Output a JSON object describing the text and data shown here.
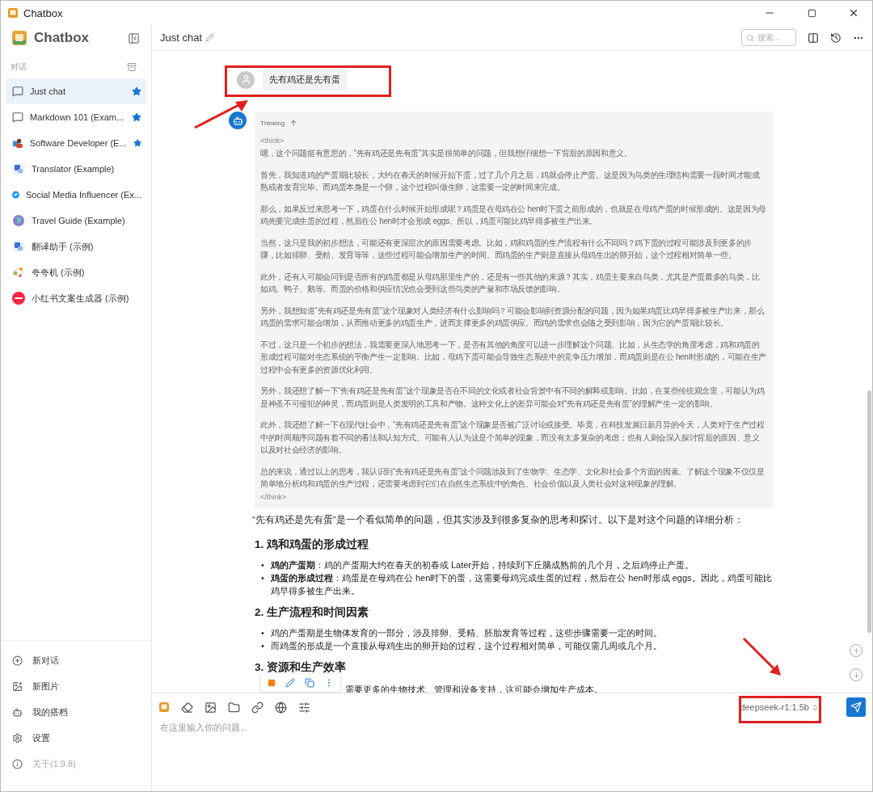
{
  "window": {
    "title": "Chatbox"
  },
  "sidebar": {
    "app_name": "Chatbox",
    "section_label": "对话",
    "items": [
      {
        "title": "Just chat",
        "kind": "chat",
        "starred": true,
        "selected": true
      },
      {
        "title": "Markdown 101 (Exam...",
        "kind": "chat",
        "starred": true,
        "selected": false
      },
      {
        "title": "Software Developer (E...",
        "kind": "developer",
        "starred": true,
        "selected": false
      },
      {
        "title": "Translator (Example)",
        "kind": "translate",
        "starred": false,
        "selected": false
      },
      {
        "title": "Social Media Influencer (Ex...",
        "kind": "bird",
        "starred": false,
        "selected": false
      },
      {
        "title": "Travel Guide (Example)",
        "kind": "globe",
        "starred": false,
        "selected": false
      },
      {
        "title": "翻译助手 (示例)",
        "kind": "translate",
        "starred": false,
        "selected": false
      },
      {
        "title": "夸夸机 (示例)",
        "kind": "sparkle",
        "starred": false,
        "selected": false
      },
      {
        "title": "小红书文案生成器 (示例)",
        "kind": "badge",
        "starred": false,
        "selected": false
      }
    ],
    "actions": [
      {
        "label": "新对话",
        "kind": "plus"
      },
      {
        "label": "新图片",
        "kind": "image"
      },
      {
        "label": "我的搭档",
        "kind": "bot"
      },
      {
        "label": "设置",
        "kind": "gear"
      },
      {
        "label": "关于(1.9.8)",
        "kind": "info"
      }
    ]
  },
  "header": {
    "title": "Just chat",
    "search_placeholder": "搜索..."
  },
  "user_message": {
    "text": "先有鸡还是先有蛋"
  },
  "thinking": {
    "label": "Thinking",
    "open_tag": "<think>",
    "close_tag": "</think>",
    "paragraphs": [
      "嗯，这个问题挺有意思的，“先有鸡还是先有蛋”其实是很简单的问题，但我想仔细想一下背后的原因和意义。",
      "首先，我知道鸡的产蛋期比较长，大约在春天的时候开始下蛋，过了几个月之后，鸡就会停止产蛋。这是因为鸟类的生理结构需要一段时间才能成熟或者发育完毕。而鸡蛋本身是一个卵，这个过程叫做生卵，这需要一定的时间来完成。",
      "那么，如果反过来思考一下，鸡蛋在什么时候开始形成呢？鸡蛋是在母鸡在公 hen时下蛋之前形成的，也就是在母鸡产蛋的时候形成的。这是因为母鸡先要完成生蛋的过程，然后在公 hen时才会形成 eggs。所以，鸡蛋可能比鸡早得多被生产出来。",
      "当然，这只是我的初步想法，可能还有更深层次的原因需要考虑。比如，鸡和鸡蛋的生产流程有什么不同吗？鸡下蛋的过程可能涉及到更多的步骤，比如排卵、受精、发育等等，这些过程可能会增加生产的时间。而鸡蛋的生产则是直接从母鸡生出的卵开始，这个过程相对简单一些。",
      "此外，还有人可能会问到是否所有的鸡蛋都是从母鸡那里生产的，还是有一些其他的来源？其实，鸡蛋主要来自鸟类，尤其是产蛋最多的鸟类，比如鸡、鸭子、鹅等。而蛋的价格和供应情况也会受到这些鸟类的产量和市场反馈的影响。",
      "另外，我想知道“先有鸡还是先有蛋”这个现象对人类经济有什么影响吗？可能会影响到资源分配的问题，因为如果鸡蛋比鸡早得多被生产出来，那么鸡蛋的需求可能会增加，从而推动更多的鸡蛋生产，进而支撑更多的鸡蛋供应。而鸡的需求也会随之受到影响，因为它的产蛋期比较长。",
      "不过，这只是一个初步的想法，我需要更深入地思考一下，是否有其他的角度可以进一步理解这个问题。比如，从生态学的角度考虑，鸡和鸡蛋的形成过程可能对生态系统的平衡产生一定影响。比如，母鸡下蛋可能会导致生态系统中的竞争压力增加，而鸡蛋则是在公 hen时形成的，可能在生产过程中会有更多的资源优化利用。",
      "另外，我还想了解一下“先有鸡还是先有蛋”这个现象是否在不同的文化或者社会背景中有不同的解释或影响。比如，在某些传统观念里，可能认为鸡是神圣不可侵犯的神灵，而鸡蛋则是人类发明的工具和产物。这种文化上的差异可能会对“先有鸡还是先有蛋”的理解产生一定的影响。",
      "此外，我还想了解一下在现代社会中，“先有鸡还是先有蛋”这个现象是否被广泛讨论或接受。毕竟，在科技发展日新月异的今天，人类对于生产过程中的时间顺序问题有着不同的看法和认知方式。可能有人认为这是个简单的现象，而没有太多复杂的考虑；也有人则会深入探讨背后的原因、意义以及对社会经济的影响。",
      "总的来说，通过以上的思考，我认识到“先有鸡还是先有蛋”这个问题涉及到了生物学、生态学、文化和社会多个方面的因素。了解这个现象不仅仅是简单地分析鸡和鸡蛋的生产过程，还需要考虑到它们在自然生态系统中的角色、社会价值以及人类社会对这种现象的理解。"
    ]
  },
  "answer": [
    {
      "kind": "paragraph",
      "text": "“先有鸡还是先有蛋”是一个看似简单的问题，但其实涉及到很多复杂的思考和探讨。以下是对这个问题的详细分析："
    },
    {
      "kind": "heading",
      "text": "1. 鸡和鸡蛋的形成过程"
    },
    {
      "kind": "bullet",
      "marker": "•",
      "text": "**鸡的产蛋期**：鸡的产蛋期大约在春天的初春或 Later开始，持续到下丘脑成熟前的几个月，之后鸡停止产蛋。"
    },
    {
      "kind": "bullet",
      "marker": "•",
      "text": "**鸡蛋的形成过程**：鸡蛋是在母鸡在公 hen时下的蛋，这需要母鸡完成生蛋的过程，然后在公 hen时形成 eggs。因此，鸡蛋可能比鸡早得多被生产出来。"
    },
    {
      "kind": "heading",
      "text": "2. 生产流程和时间因素"
    },
    {
      "kind": "bullet",
      "marker": "•",
      "text": "鸡的产蛋期是生物体发育的一部分，涉及排卵、受精、胚胎发育等过程，这些步骤需要一定的时间。"
    },
    {
      "kind": "bullet",
      "marker": "•",
      "text": "而鸡蛋的形成是一个直接从母鸡生出的卵开始的过程，这个过程相对简单，可能仅需几周或几个月。"
    },
    {
      "kind": "heading",
      "text": "3. 资源和生产效率"
    },
    {
      "kind": "fragment",
      "text": "需要更多的生物技术、管理和设备支持，这可能会增加生产成本。"
    }
  ],
  "composer": {
    "placeholder": "在这里输入你的问题...",
    "model": "deepseek-r1:1.5b"
  }
}
